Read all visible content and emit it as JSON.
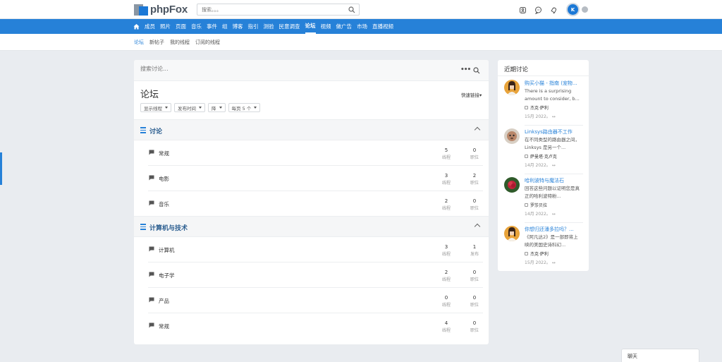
{
  "header": {
    "logo_text": "phpFox",
    "search_placeholder": "搜索。。。",
    "icons": [
      "contacts-icon",
      "chat-icon",
      "bell-icon"
    ],
    "avatar_text": "K"
  },
  "nav": {
    "items": [
      "成员",
      "照片",
      "页面",
      "音乐",
      "事件",
      "组",
      "博客",
      "指引",
      "测验",
      "民意调查",
      "论坛",
      "视频",
      "做广告",
      "市场",
      "直播视频"
    ],
    "active": "论坛"
  },
  "subnav": {
    "items": [
      "论坛",
      "新帖子",
      "我的线程",
      "订阅的线程"
    ],
    "active": "论坛"
  },
  "main": {
    "search_placeholder": "搜索讨论...",
    "title": "论坛",
    "quick_link": "快速链接▾",
    "filters": [
      "显示线程",
      "发布时间",
      "降",
      "每页 5 个"
    ]
  },
  "categories": [
    {
      "title": "讨论",
      "forums": [
        {
          "name": "常规",
          "threads": "5",
          "threads_label": "线程",
          "posts": "0",
          "posts_label": "职位"
        },
        {
          "name": "电影",
          "threads": "3",
          "threads_label": "线程",
          "posts": "2",
          "posts_label": "职位"
        },
        {
          "name": "音乐",
          "threads": "2",
          "threads_label": "线程",
          "posts": "0",
          "posts_label": "职位"
        }
      ]
    },
    {
      "title": "计算机与技术",
      "forums": [
        {
          "name": "计算机",
          "threads": "3",
          "threads_label": "线程",
          "posts": "1",
          "posts_label": "发布"
        },
        {
          "name": "电子学",
          "threads": "2",
          "threads_label": "线程",
          "posts": "0",
          "posts_label": "职位"
        },
        {
          "name": "产品",
          "threads": "0",
          "threads_label": "线程",
          "posts": "0",
          "posts_label": "职位"
        },
        {
          "name": "常规",
          "threads": "4",
          "threads_label": "线程",
          "posts": "0",
          "posts_label": "职位"
        }
      ]
    }
  ],
  "recent": {
    "title": "近期讨论",
    "items": [
      {
        "title": "购买小猫 - 指南 (宠物...",
        "text": "There is a surprising amount to consider, b...",
        "author": "杰克·萨利",
        "meta": "15月 2022。 ↔",
        "avatar_color": "#e8a33a"
      },
      {
        "title": "Linksys路由器不工作",
        "text": "在不同类型的路由器之间， Linksys 是另一个...",
        "author": "萨曼塔·克卢克",
        "meta": "14月 2022。 ↔",
        "avatar_color": "#b9876a"
      },
      {
        "title": "哈利波特与魔法石",
        "text": "回答这些问题以证明您是真正的哈利波特粉...",
        "author": "罗莎贝拉",
        "meta": "14月 2022。 ↔",
        "avatar_color": "#c0233a"
      },
      {
        "title": "你想归还潘多拉吗？...",
        "text": "《阿凡达2》是一部即将上映的美国史诗科幻...",
        "author": "杰克·萨利",
        "meta": "15月 2022。 ↔",
        "avatar_color": "#e8a33a"
      }
    ]
  },
  "chat": {
    "label": "聊天"
  }
}
